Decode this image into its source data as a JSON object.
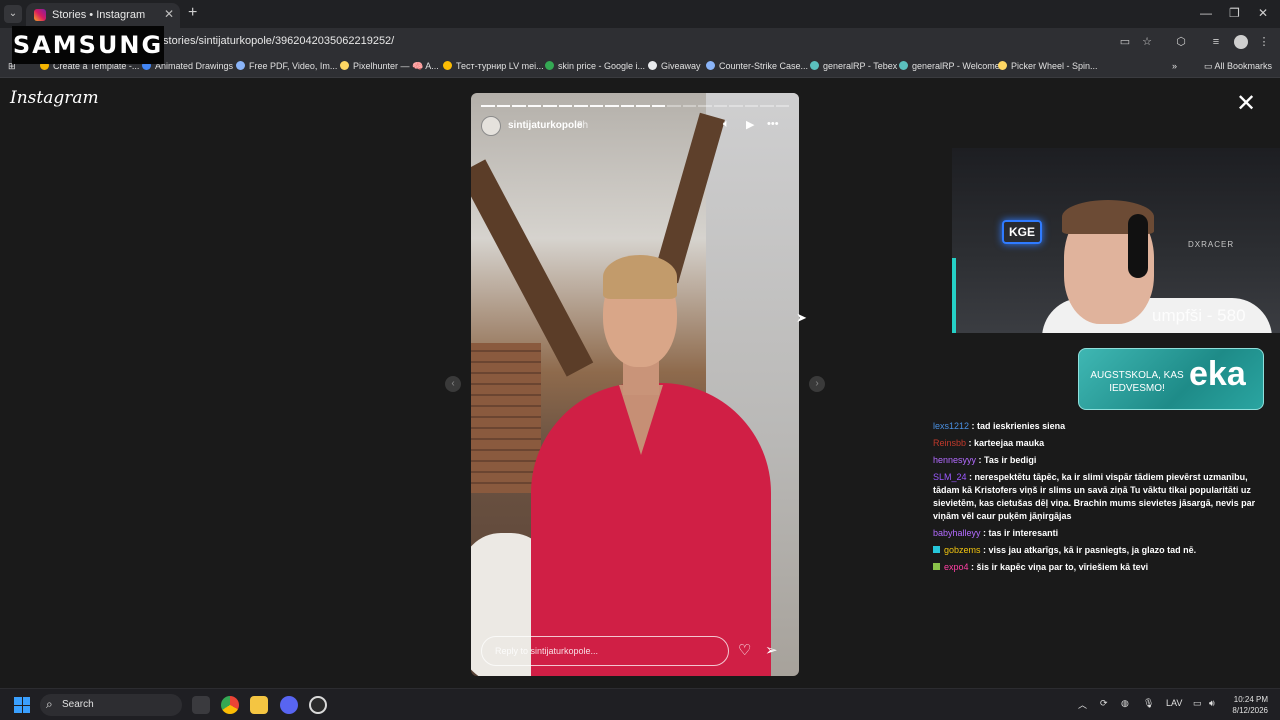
{
  "browser": {
    "tab_title": "Stories • Instagram",
    "url": "/stories/sintijaturkopole/3962042035062219252/",
    "bookmarks": [
      {
        "label": "Create a Template -...",
        "color": "#f4b400"
      },
      {
        "label": "Animated Drawings",
        "color": "#4285f4"
      },
      {
        "label": "Free PDF, Video, Im...",
        "color": "#8ab4f8"
      },
      {
        "label": "Pixelhunter — 🧠 A...",
        "color": "#fdd663"
      },
      {
        "label": "Тест-турнир LV mei...",
        "color": "#fbbc04"
      },
      {
        "label": "skin price - Google i...",
        "color": "#34a853"
      },
      {
        "label": "Giveaway",
        "color": "#e8eaed"
      },
      {
        "label": "Counter-Strike Case...",
        "color": "#8ab4f8"
      },
      {
        "label": "generalRP - Tebex",
        "color": "#5bc0be"
      },
      {
        "label": "generalRP - Welcome",
        "color": "#5bc0be"
      },
      {
        "label": "Picker Wheel - Spin...",
        "color": "#fdd663"
      }
    ],
    "all_bookmarks": "All Bookmarks"
  },
  "overlay": {
    "samsung": "SAMSUNG"
  },
  "instagram": {
    "logo": "Instagram",
    "close": "✕",
    "story": {
      "username": "sintijaturkopole",
      "time": "8h",
      "segments_total": 20,
      "segments_done": 12,
      "reply_placeholder": "Reply to sintijaturkopole..."
    }
  },
  "stream": {
    "cam_sign": "KGE",
    "cam_brand": "DXRACER",
    "cam_overlay_text": "umpfši - 580",
    "ad_text": "AUGSTSKOLA, KAS IEDVESMO!",
    "ad_brand": "eka",
    "chat": [
      {
        "user": "lexs1212",
        "color": "#4a90e2",
        "text": ": tad ieskrienies siena"
      },
      {
        "user": "Reinsbb",
        "color": "#c0392b",
        "text": ": karteejaa mauka"
      },
      {
        "user": "hennesyyy",
        "color": "#b36bff",
        "text": ": Tas ir bedigi"
      },
      {
        "user": "SLM_24",
        "color": "#9b59ff",
        "text": ": nerespektētu tāpēc, ka ir slimi vispār tādiem pievērst uzmanību, tādam kā Kristofers viņš ir slims un savā ziņā Tu vāktu tikai popularitāti uz sievietēm, kas cietušas dēļ viņa. Brachin mums sievietes jāsargā, nevis par viņām vēl caur puķēm jāņirgājas"
      },
      {
        "user": "babyhalleyy",
        "color": "#b36bff",
        "text": ": tas ir interesanti"
      },
      {
        "user": "gobzems",
        "color": "#f1c40f",
        "text": ": viss jau atkarīgs, kā ir pasniegts, ja glazo tad nē."
      },
      {
        "user": "expo4",
        "color": "#ff3fa4",
        "text": ": šis ir kapēc viņa par to, vīriešiem kā tevi"
      }
    ]
  },
  "taskbar": {
    "search": "Search",
    "lang": "LAV",
    "time": "10:24 PM",
    "date": "8/12/2026"
  }
}
